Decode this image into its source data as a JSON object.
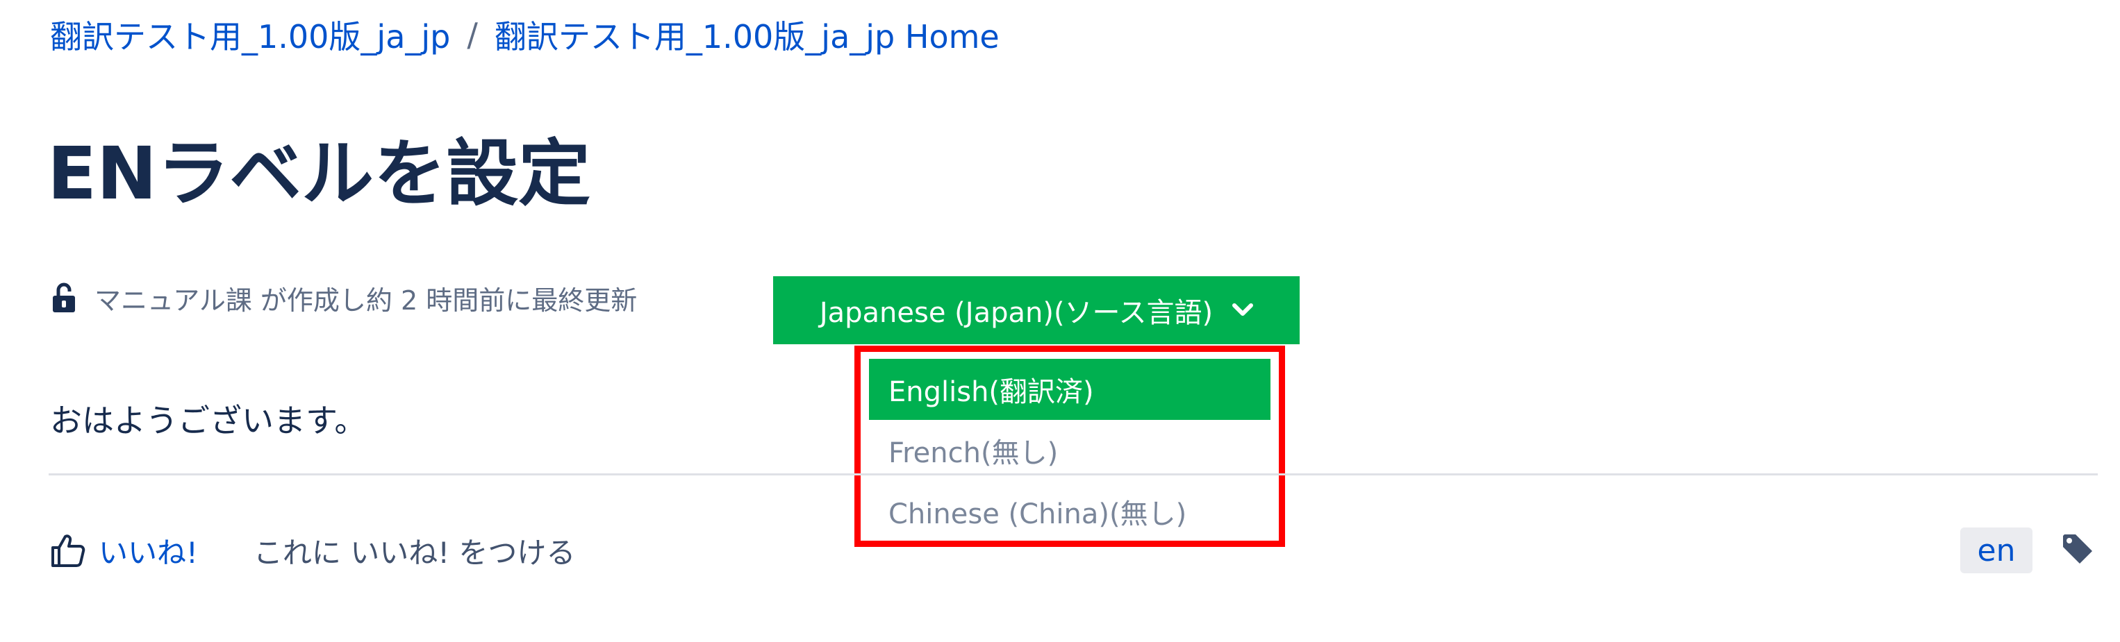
{
  "breadcrumb": {
    "space": "翻訳テスト用_1.00版_ja_jp",
    "separator": "/",
    "home": "翻訳テスト用_1.00版_ja_jp Home"
  },
  "page": {
    "title": "ENラベルを設定"
  },
  "byline": {
    "icon": "unlock-icon",
    "author": "マニュアル課",
    "text": "が作成し約 2 時間前に最終更新"
  },
  "language_selector": {
    "label": "Japanese (Japan)(ソース言語)",
    "icon": "chevron-down-icon",
    "color": "#00b050",
    "options": [
      {
        "label": "English(翻訳済)",
        "active": true
      },
      {
        "label": "French(無し)",
        "active": false
      },
      {
        "label": "Chinese (China)(無し)",
        "active": false
      }
    ],
    "highlight_color": "#ff0000"
  },
  "content": {
    "text": "おはようございます。"
  },
  "footer": {
    "like_icon": "thumbs-up-icon",
    "like_link": "いいね!",
    "like_prompt": "これに いいね! をつける",
    "label": "en",
    "tag_icon": "tag-icon"
  }
}
